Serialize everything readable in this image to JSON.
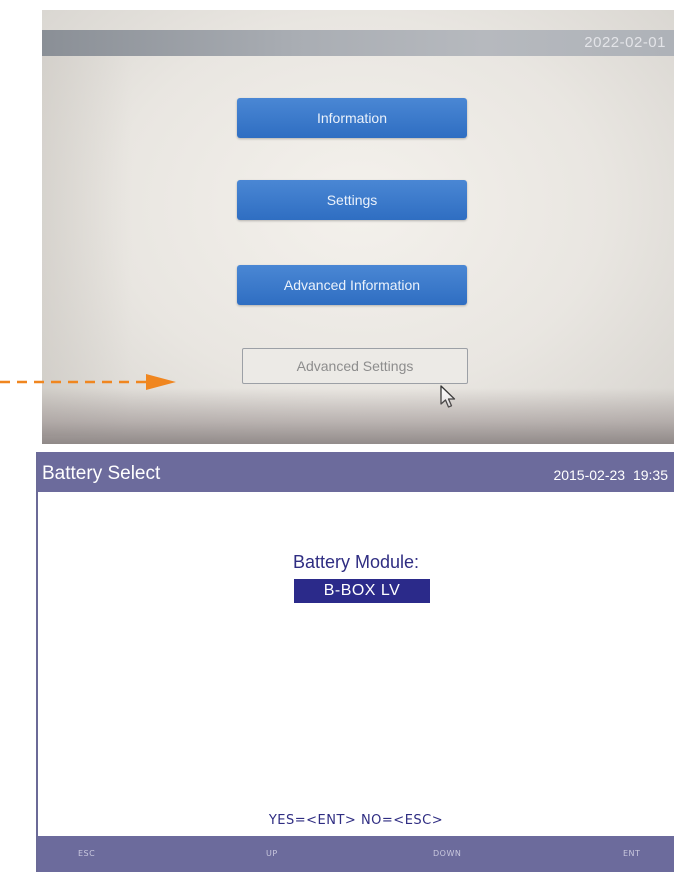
{
  "photo": {
    "date": "2022-02-01",
    "buttons": {
      "information": "Information",
      "settings": "Settings",
      "advanced_information": "Advanced Information",
      "advanced_settings": "Advanced Settings"
    },
    "accent_color": "#f0861f",
    "button_color": "#3a78c9"
  },
  "screen": {
    "title": "Battery Select",
    "datetime": "2015-02-23  19:35",
    "battery_label": "Battery Module:",
    "battery_value": "B-BOX LV",
    "prompt": "YES=<ENT>  NO=<ESC>",
    "keys": {
      "esc": "ESC",
      "up": "UP",
      "down": "DOWN",
      "ent": "ENT"
    },
    "header_color": "#6c6b9c",
    "highlight_color": "#2b2a8a"
  }
}
